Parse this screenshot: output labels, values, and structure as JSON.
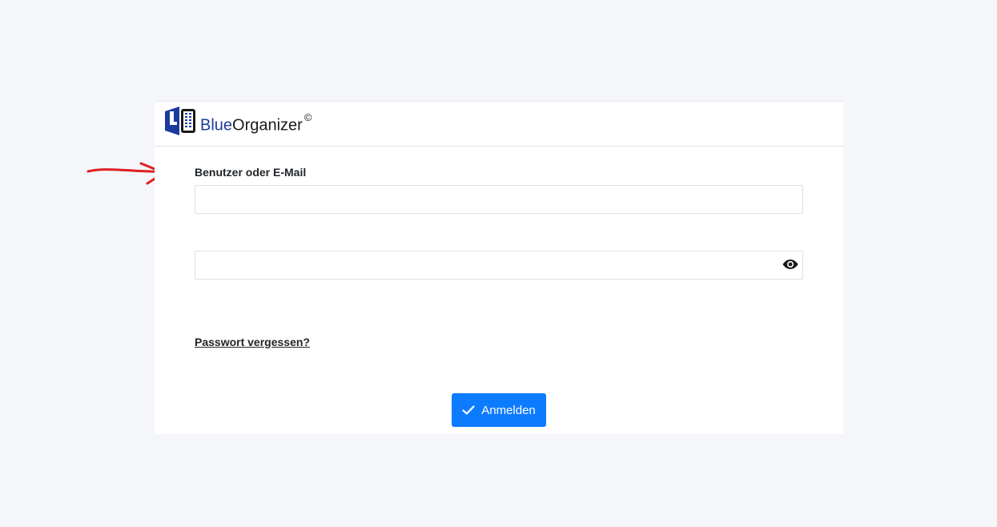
{
  "brand": {
    "part1": "Blue",
    "part2": "Organizer",
    "copyright": "©",
    "logo_icon": "logo-l-icon",
    "logo_color": "#1c3c9c"
  },
  "form": {
    "username_label": "Benutzer oder E-Mail",
    "username_value": "",
    "password_value": "",
    "show_password_icon": "eye-icon",
    "forgot_link": "Passwort vergessen?",
    "login_button": "Anmelden",
    "login_icon": "check-icon"
  },
  "annotation": {
    "icon": "red-arrow-question-mark-icon",
    "color": "#e02020"
  },
  "colors": {
    "background": "#f4f6fa",
    "primary": "#0d7bff",
    "brand_blue": "#1c3c9c"
  }
}
